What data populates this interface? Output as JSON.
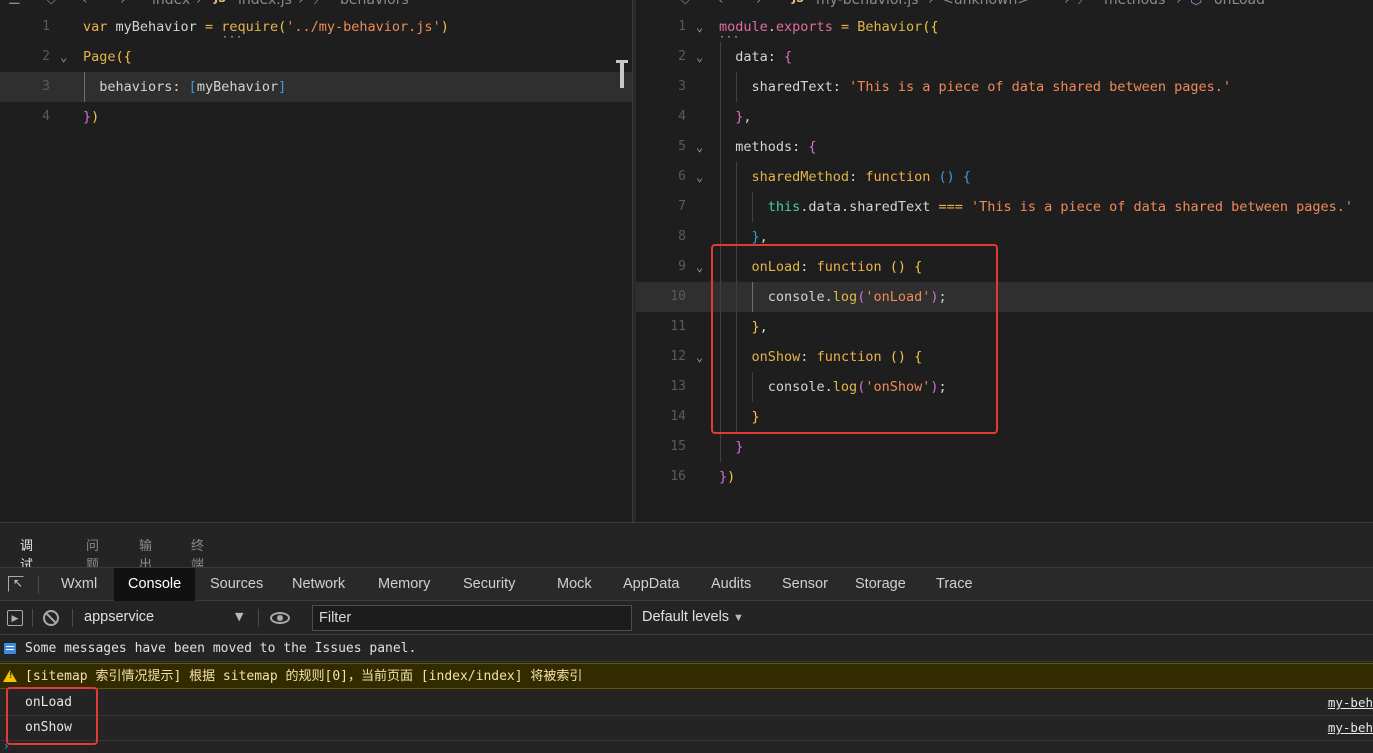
{
  "left_editor": {
    "breadcrumb": [
      "index",
      "index.js",
      "behaviors"
    ],
    "js_badge": "JS",
    "lines": [
      {
        "n": "1",
        "parts": [
          [
            "kw2",
            "var"
          ],
          [
            "var",
            " myBehavior "
          ],
          [
            "kw2",
            "="
          ],
          [
            "var",
            " "
          ],
          [
            "fn",
            "require"
          ],
          [
            "yl",
            "("
          ],
          [
            "str",
            "'../my-behavior.js'"
          ],
          [
            "yl",
            ")"
          ]
        ]
      },
      {
        "n": "2",
        "parts": [
          [
            "fn",
            "Page"
          ],
          [
            "yl",
            "({"
          ]
        ]
      },
      {
        "n": "3",
        "parts": [
          [
            "prop",
            "  behaviors"
          ],
          [
            "var",
            ": "
          ],
          [
            "bl",
            "["
          ],
          [
            "var",
            "myBehavior"
          ],
          [
            "bl",
            "]"
          ]
        ]
      },
      {
        "n": "4",
        "parts": [
          [
            "pk",
            "}"
          ],
          [
            "yl",
            ")"
          ]
        ]
      }
    ]
  },
  "right_editor": {
    "breadcrumb": [
      "my-behavior.js",
      "<unknown>",
      "methods",
      "onLoad"
    ],
    "js_badge": "JS",
    "lines": [
      {
        "n": "1",
        "parts": [
          [
            "mod",
            "module"
          ],
          [
            "var",
            "."
          ],
          [
            "mod",
            "exports"
          ],
          [
            "var",
            " "
          ],
          [
            "kw2",
            "="
          ],
          [
            "var",
            " "
          ],
          [
            "fn",
            "Behavior"
          ],
          [
            "yl",
            "({"
          ]
        ]
      },
      {
        "n": "2",
        "parts": [
          [
            "var",
            "  data"
          ],
          [
            "var",
            ": "
          ],
          [
            "pk",
            "{"
          ]
        ]
      },
      {
        "n": "3",
        "parts": [
          [
            "var",
            "    sharedText"
          ],
          [
            "var",
            ": "
          ],
          [
            "str",
            "'This is a piece of data shared between pages.'"
          ]
        ]
      },
      {
        "n": "4",
        "parts": [
          [
            "var",
            "  "
          ],
          [
            "pk",
            "}"
          ],
          [
            "var",
            ","
          ]
        ]
      },
      {
        "n": "5",
        "parts": [
          [
            "var",
            "  methods"
          ],
          [
            "var",
            ": "
          ],
          [
            "pk",
            "{"
          ]
        ]
      },
      {
        "n": "6",
        "parts": [
          [
            "var",
            "    "
          ],
          [
            "fn",
            "sharedMethod"
          ],
          [
            "var",
            ": "
          ],
          [
            "kw2",
            "function"
          ],
          [
            "var",
            " "
          ],
          [
            "bl",
            "()"
          ],
          [
            "var",
            " "
          ],
          [
            "bl",
            "{"
          ]
        ]
      },
      {
        "n": "7",
        "parts": [
          [
            "var",
            "      "
          ],
          [
            "teal",
            "this"
          ],
          [
            "var",
            ".data.sharedText "
          ],
          [
            "kw2",
            "==="
          ],
          [
            "var",
            " "
          ],
          [
            "str",
            "'This is a piece of data shared between pages.'"
          ]
        ]
      },
      {
        "n": "8",
        "parts": [
          [
            "var",
            "    "
          ],
          [
            "bl",
            "}"
          ],
          [
            "var",
            ","
          ]
        ]
      },
      {
        "n": "9",
        "parts": [
          [
            "var",
            "    "
          ],
          [
            "fn",
            "onLoad"
          ],
          [
            "var",
            ": "
          ],
          [
            "kw2",
            "function"
          ],
          [
            "var",
            " "
          ],
          [
            "yl",
            "()"
          ],
          [
            "var",
            " "
          ],
          [
            "yl",
            "{"
          ]
        ]
      },
      {
        "n": "10",
        "parts": [
          [
            "var",
            "      console."
          ],
          [
            "fn",
            "log"
          ],
          [
            "pk",
            "("
          ],
          [
            "str",
            "'onLoad'"
          ],
          [
            "pk",
            ")"
          ],
          [
            "var",
            ";"
          ]
        ]
      },
      {
        "n": "11",
        "parts": [
          [
            "var",
            "    "
          ],
          [
            "yl",
            "}"
          ],
          [
            "var",
            ","
          ]
        ]
      },
      {
        "n": "12",
        "parts": [
          [
            "var",
            "    "
          ],
          [
            "fn",
            "onShow"
          ],
          [
            "var",
            ": "
          ],
          [
            "kw2",
            "function"
          ],
          [
            "var",
            " "
          ],
          [
            "yl",
            "()"
          ],
          [
            "var",
            " "
          ],
          [
            "yl",
            "{"
          ]
        ]
      },
      {
        "n": "13",
        "parts": [
          [
            "var",
            "      console."
          ],
          [
            "fn",
            "log"
          ],
          [
            "pk",
            "("
          ],
          [
            "str",
            "'onShow'"
          ],
          [
            "pk",
            ")"
          ],
          [
            "var",
            ";"
          ]
        ]
      },
      {
        "n": "14",
        "parts": [
          [
            "var",
            "    "
          ],
          [
            "yl",
            "}"
          ]
        ]
      },
      {
        "n": "15",
        "parts": [
          [
            "var",
            "  "
          ],
          [
            "pk",
            "}"
          ]
        ]
      },
      {
        "n": "16",
        "parts": [
          [
            "pk",
            "}"
          ],
          [
            "yl",
            ")"
          ]
        ]
      }
    ]
  },
  "panel_tabs": [
    "调试器",
    "问题",
    "输出",
    "终端"
  ],
  "devtools_tabs": [
    "Wxml",
    "Console",
    "Sources",
    "Network",
    "Memory",
    "Security",
    "Mock",
    "AppData",
    "Audits",
    "Sensor",
    "Storage",
    "Trace"
  ],
  "console": {
    "context": "appservice",
    "filter_placeholder": "Filter",
    "levels": "Default levels",
    "messages": [
      {
        "type": "info",
        "text": "Some messages have been moved to the Issues panel.",
        "source": ""
      },
      {
        "type": "warning",
        "text": "[sitemap 索引情况提示] 根据 sitemap 的规则[0]，当前页面 [index/index] 将被索引",
        "source": ""
      },
      {
        "type": "log",
        "text": "onLoad",
        "source": "my-beh"
      },
      {
        "type": "log",
        "text": "onShow",
        "source": "my-beh"
      }
    ]
  },
  "colors": {
    "highlight_box": "#e53935",
    "warning_bg": "#332b00",
    "active_tab_bg": "#111111"
  }
}
